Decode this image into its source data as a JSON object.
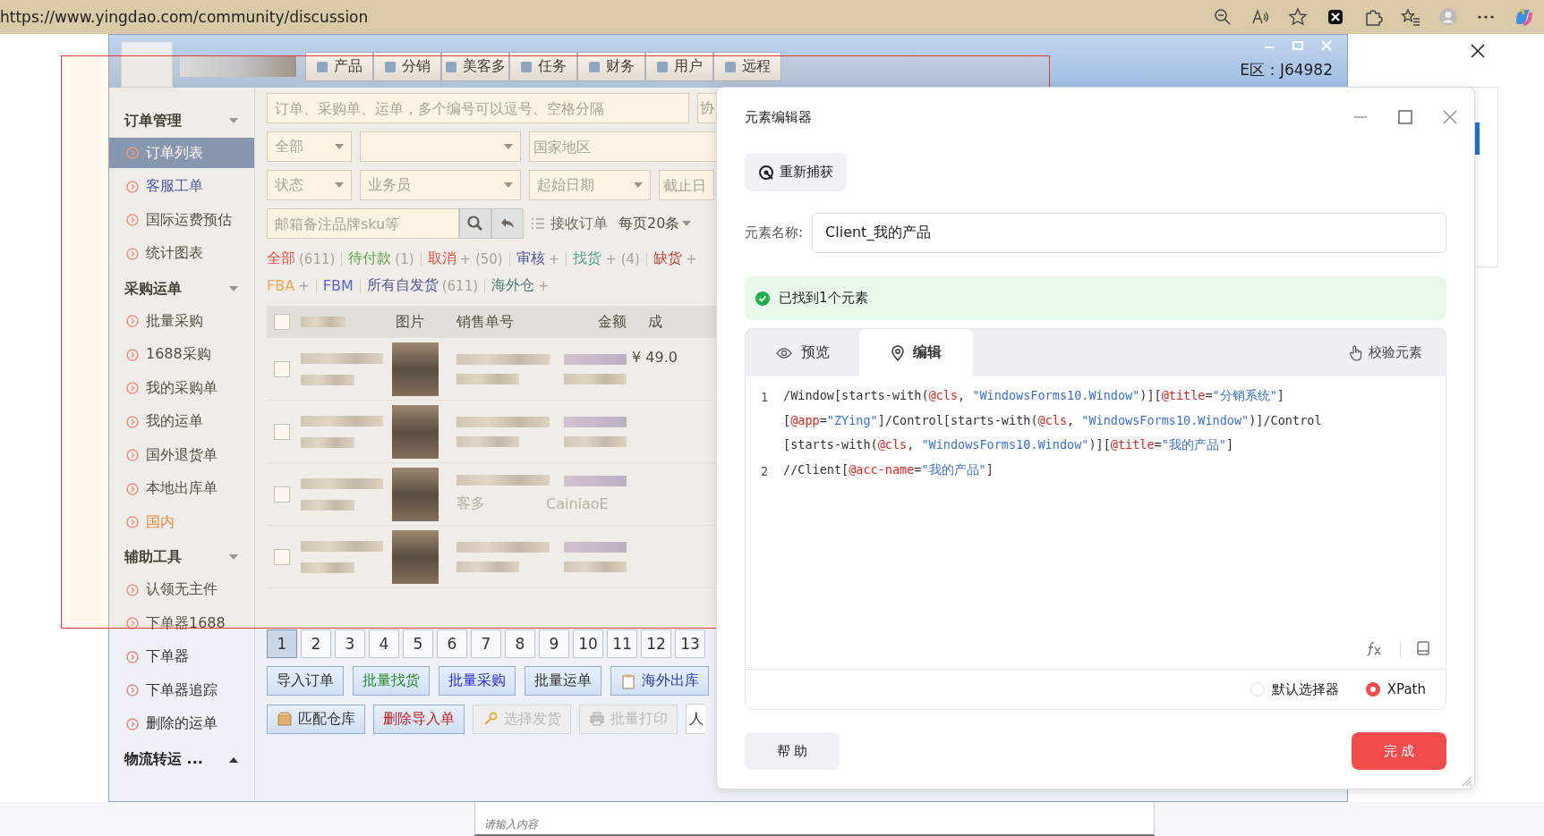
{
  "browser": {
    "url": "https://www.yingdao.com/community/discussion"
  },
  "app": {
    "tabs": [
      {
        "label": "产品",
        "selected": false
      },
      {
        "label": "分销",
        "selected": false
      },
      {
        "label": "美客多",
        "selected": false
      },
      {
        "label": "任务",
        "selected": false
      },
      {
        "label": "财务",
        "selected": false
      },
      {
        "label": "用户",
        "selected": false
      },
      {
        "label": "远程",
        "selected": false
      }
    ],
    "zone": "E区：J64982",
    "sidebar": [
      {
        "title": "订单管理",
        "expanded": true,
        "items": [
          {
            "label": "订单列表",
            "selected": true,
            "kind": "normal"
          },
          {
            "label": "客服工单",
            "selected": false,
            "kind": "visited"
          },
          {
            "label": "国际运费预估",
            "selected": false,
            "kind": "normal"
          },
          {
            "label": "统计图表",
            "selected": false,
            "kind": "normal"
          }
        ]
      },
      {
        "title": "采购运单",
        "expanded": true,
        "items": [
          {
            "label": "批量采购",
            "selected": false,
            "kind": "normal"
          },
          {
            "label": "1688采购",
            "selected": false,
            "kind": "normal"
          },
          {
            "label": "我的采购单",
            "selected": false,
            "kind": "normal"
          },
          {
            "label": "我的运单",
            "selected": false,
            "kind": "normal"
          },
          {
            "label": "国外退货单",
            "selected": false,
            "kind": "normal"
          },
          {
            "label": "本地出库单",
            "selected": false,
            "kind": "normal"
          },
          {
            "label": "国内",
            "selected": false,
            "kind": "accent"
          }
        ]
      },
      {
        "title": "辅助工具",
        "expanded": true,
        "items": [
          {
            "label": "认领无主件",
            "selected": false,
            "kind": "normal"
          },
          {
            "label": "下单器1688",
            "selected": false,
            "kind": "normal"
          },
          {
            "label": "下单器",
            "selected": false,
            "kind": "normal"
          },
          {
            "label": "下单器追踪",
            "selected": false,
            "kind": "normal"
          },
          {
            "label": "删除的运单",
            "selected": false,
            "kind": "normal"
          }
        ]
      },
      {
        "title": "物流转运 ...",
        "expanded": false
      }
    ],
    "search": {
      "placeholder": "订单、采购单、运单，多个编号可以逗号、空格分隔",
      "side_field": "协"
    },
    "filter_row_1": [
      {
        "kind": "select",
        "value": "全部"
      },
      {
        "kind": "select"
      },
      {
        "kind": "input",
        "placeholder": "国家地区"
      }
    ],
    "filter_row_2": [
      {
        "kind": "select",
        "value": "状态"
      },
      {
        "kind": "select",
        "value": "业务员"
      },
      {
        "kind": "select",
        "value": "起始日期"
      },
      {
        "kind": "input",
        "placeholder": "截止日"
      }
    ],
    "keyword": {
      "placeholder": "邮箱备注品牌sku等",
      "receive_label": "接收订单",
      "page_size": "每页20条"
    },
    "status_links": [
      {
        "label": "全部",
        "count": "(611)",
        "kind": "red"
      },
      {
        "label": "待付款",
        "count": "(1)",
        "kind": "green"
      },
      {
        "label": "取消",
        "count": "+ (50)",
        "kind": "red"
      },
      {
        "label": "审核",
        "count": "+",
        "kind": "navy"
      },
      {
        "label": "找货",
        "count": "+ (4)",
        "kind": "teal"
      },
      {
        "label": "缺货",
        "count": "+",
        "kind": "maroon"
      }
    ],
    "channel_links": [
      {
        "label": "FBA",
        "count": "+",
        "kind": "orange"
      },
      {
        "label": "FBM",
        "kind": "blue"
      },
      {
        "label": "所有自发货",
        "count": "(611)",
        "kind": "navy"
      },
      {
        "label": "海外仓",
        "count": "+",
        "kind": "slate"
      }
    ],
    "table": {
      "header_checked": false,
      "columns": [
        "图片",
        "销售单号",
        "金额",
        "成"
      ],
      "rows": [
        {
          "checked": false,
          "amount": "¥ 49.0"
        },
        {
          "checked": false
        },
        {
          "checked": false,
          "sale_note": "客多",
          "carrier": "CainiaoE"
        },
        {
          "checked": false
        }
      ]
    },
    "pages": [
      {
        "label": "1",
        "selected": true
      },
      {
        "label": "2",
        "selected": false
      },
      {
        "label": "3",
        "selected": false
      },
      {
        "label": "4",
        "selected": false
      },
      {
        "label": "5",
        "selected": false
      },
      {
        "label": "6",
        "selected": false
      },
      {
        "label": "7",
        "selected": false
      },
      {
        "label": "8",
        "selected": false
      },
      {
        "label": "9",
        "selected": false
      },
      {
        "label": "10",
        "selected": false
      },
      {
        "label": "11",
        "selected": false
      },
      {
        "label": "12",
        "selected": false
      },
      {
        "label": "13",
        "selected": false
      }
    ],
    "actions_1": [
      {
        "label": "导入订单",
        "kind": "plain",
        "disabled": false
      },
      {
        "label": "批量找货",
        "kind": "find",
        "disabled": false
      },
      {
        "label": "批量采购",
        "kind": "purchase",
        "disabled": false
      },
      {
        "label": "批量运单",
        "kind": "plain",
        "disabled": false
      },
      {
        "label": "海外出库",
        "kind": "clipboard",
        "disabled": false
      }
    ],
    "actions_2": [
      {
        "label": "匹配仓库",
        "kind": "box",
        "disabled": false
      },
      {
        "label": "删除导入单",
        "kind": "delete",
        "disabled": false
      },
      {
        "label": "选择发货",
        "kind": "key",
        "disabled": true
      },
      {
        "label": "批量打印",
        "kind": "printer",
        "disabled": true
      }
    ],
    "side_input": "人"
  },
  "dialog": {
    "title": "元素编辑器",
    "recapture": "重新捕获",
    "name_label": "元素名称:",
    "name_value": "Client_我的产品",
    "found": "已找到1个元素",
    "tabs": [
      {
        "label": "预览",
        "selected": false
      },
      {
        "label": "编辑",
        "selected": true
      }
    ],
    "verify": "校验元素",
    "code": [
      {
        "number": "1",
        "rows": [
          "/Window[starts-with(@cls, \"WindowsForms10.Window\")][@title=\"分销系统\"]",
          "[@app=\"ZYing\"]/Control[starts-with(@cls, \"WindowsForms10.Window\")]/Control",
          "[starts-with(@cls, \"WindowsForms10.Window\")][@title=\"我的产品\"]"
        ]
      },
      {
        "number": "2",
        "rows": [
          "//Client[@acc-name=\"我的产品\"]"
        ]
      }
    ],
    "selectors": [
      {
        "label": "默认选择器",
        "selected": false
      },
      {
        "label": "XPath",
        "selected": true
      }
    ],
    "help": "帮 助",
    "done": "完 成"
  },
  "page": {
    "input_placeholder": "请输入内容"
  }
}
